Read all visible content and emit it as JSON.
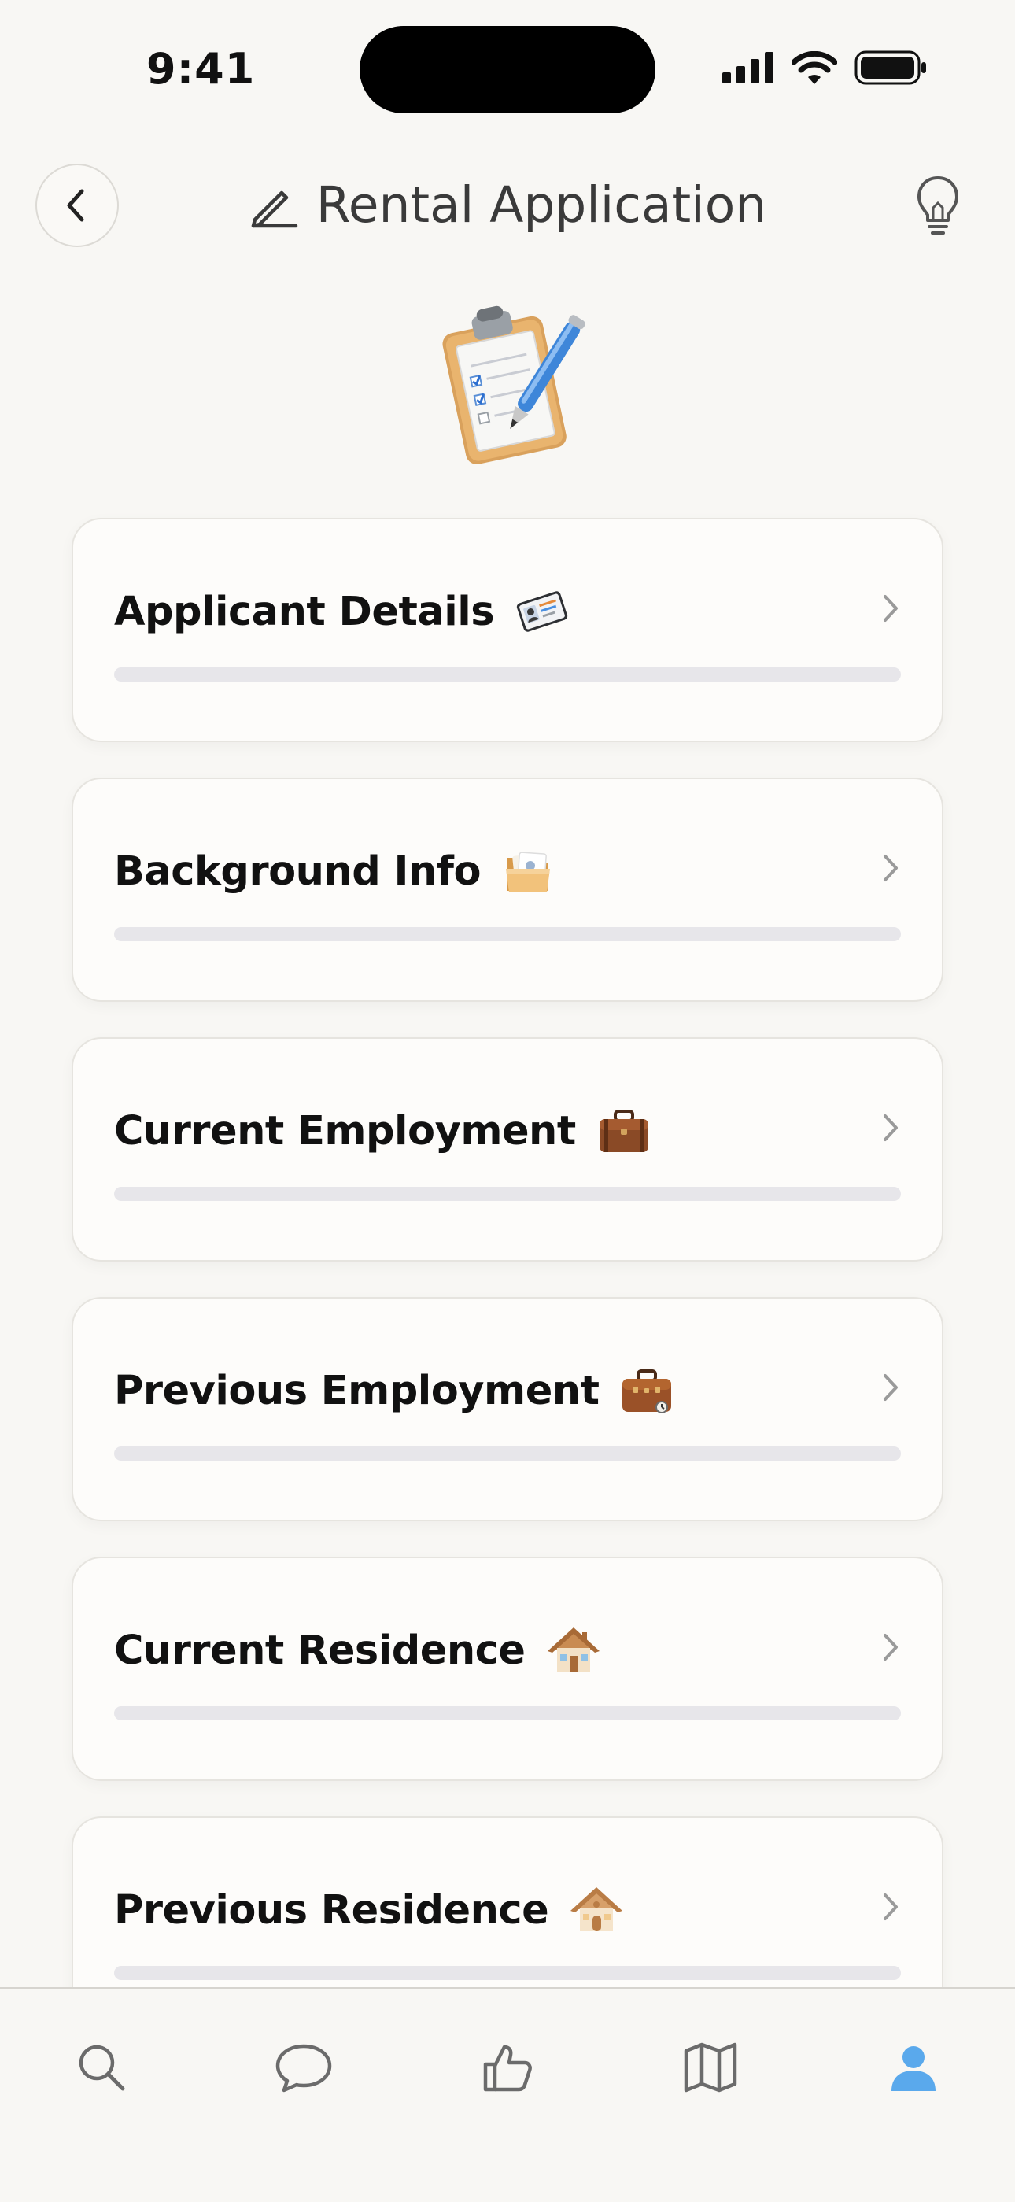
{
  "status_bar": {
    "time": "9:41"
  },
  "header": {
    "title": "Rental Application"
  },
  "sections": [
    {
      "label": "Applicant Details",
      "icon": "id-card-icon",
      "progress": 0
    },
    {
      "label": "Background Info",
      "icon": "folder-icon",
      "progress": 0
    },
    {
      "label": "Current Employment",
      "icon": "briefcase-icon",
      "progress": 0
    },
    {
      "label": "Previous Employment",
      "icon": "briefcase-icon",
      "progress": 0
    },
    {
      "label": "Current Residence",
      "icon": "house-icon",
      "progress": 0
    },
    {
      "label": "Previous Residence",
      "icon": "house-icon",
      "progress": 0
    }
  ],
  "tab_bar": {
    "tabs": [
      {
        "icon": "search-icon",
        "active": false
      },
      {
        "icon": "chat-icon",
        "active": false
      },
      {
        "icon": "thumbs-up-icon",
        "active": false
      },
      {
        "icon": "map-icon",
        "active": false
      },
      {
        "icon": "profile-icon",
        "active": true
      }
    ]
  },
  "colors": {
    "background": "#f8f7f4",
    "active_tab": "#5aa9ec",
    "inactive_tab": "#6b6b6b"
  }
}
